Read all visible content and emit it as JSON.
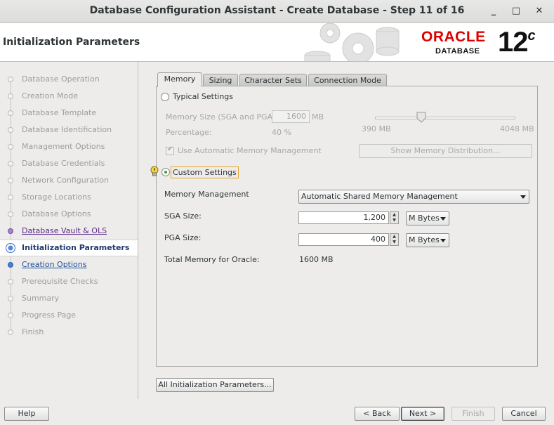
{
  "window": {
    "title": "Database Configuration Assistant - Create Database - Step 11 of 16",
    "minimize": "_",
    "maximize": "□",
    "close": "✕"
  },
  "header": {
    "page_title": "Initialization Parameters",
    "brand": "ORACLE",
    "product": "DATABASE",
    "version": "12",
    "version_suffix": "c",
    "brand_color": "#e00000"
  },
  "sidebar": {
    "steps": [
      {
        "label": "Database Operation",
        "state": "disabled"
      },
      {
        "label": "Creation Mode",
        "state": "disabled"
      },
      {
        "label": "Database Template",
        "state": "disabled"
      },
      {
        "label": "Database Identification",
        "state": "disabled"
      },
      {
        "label": "Management Options",
        "state": "disabled"
      },
      {
        "label": "Database Credentials",
        "state": "disabled"
      },
      {
        "label": "Network Configuration",
        "state": "disabled"
      },
      {
        "label": "Storage Locations",
        "state": "disabled"
      },
      {
        "label": "Database Options",
        "state": "disabled"
      },
      {
        "label": "Database Vault & OLS",
        "state": "visited"
      },
      {
        "label": "Initialization Parameters",
        "state": "current"
      },
      {
        "label": "Creation Options",
        "state": "next"
      },
      {
        "label": "Prerequisite Checks",
        "state": "disabled"
      },
      {
        "label": "Summary",
        "state": "disabled"
      },
      {
        "label": "Progress Page",
        "state": "disabled"
      },
      {
        "label": "Finish",
        "state": "disabled"
      }
    ]
  },
  "tabs": [
    {
      "label": "Memory",
      "active": true
    },
    {
      "label": "Sizing",
      "active": false
    },
    {
      "label": "Character Sets",
      "active": false
    },
    {
      "label": "Connection Mode",
      "active": false
    }
  ],
  "memory": {
    "typical_label": "Typical Settings",
    "memory_size_label": "Memory Size (SGA and PGA):",
    "memory_size_value": "1600",
    "memory_size_unit": "MB",
    "percentage_label": "Percentage:",
    "percentage_value": "40 %",
    "slider_min": "390 MB",
    "slider_max": "4048 MB",
    "slider_value_mb": 1600,
    "use_amm_label": "Use Automatic Memory Management",
    "show_distribution_label": "Show Memory Distribution...",
    "custom_label": "Custom Settings",
    "selected_mode": "custom",
    "memory_management_label": "Memory Management",
    "memory_management_value": "Automatic Shared Memory Management",
    "sga_label": "SGA Size:",
    "sga_value": "1,200",
    "sga_unit": "M Bytes",
    "pga_label": "PGA Size:",
    "pga_value": "400",
    "pga_unit": "M Bytes",
    "total_label": "Total Memory for Oracle:",
    "total_value": "1600 MB"
  },
  "buttons": {
    "all_params": "All Initialization Parameters...",
    "help": "Help",
    "back": "< Back",
    "next": "Next >",
    "finish": "Finish",
    "cancel": "Cancel"
  }
}
